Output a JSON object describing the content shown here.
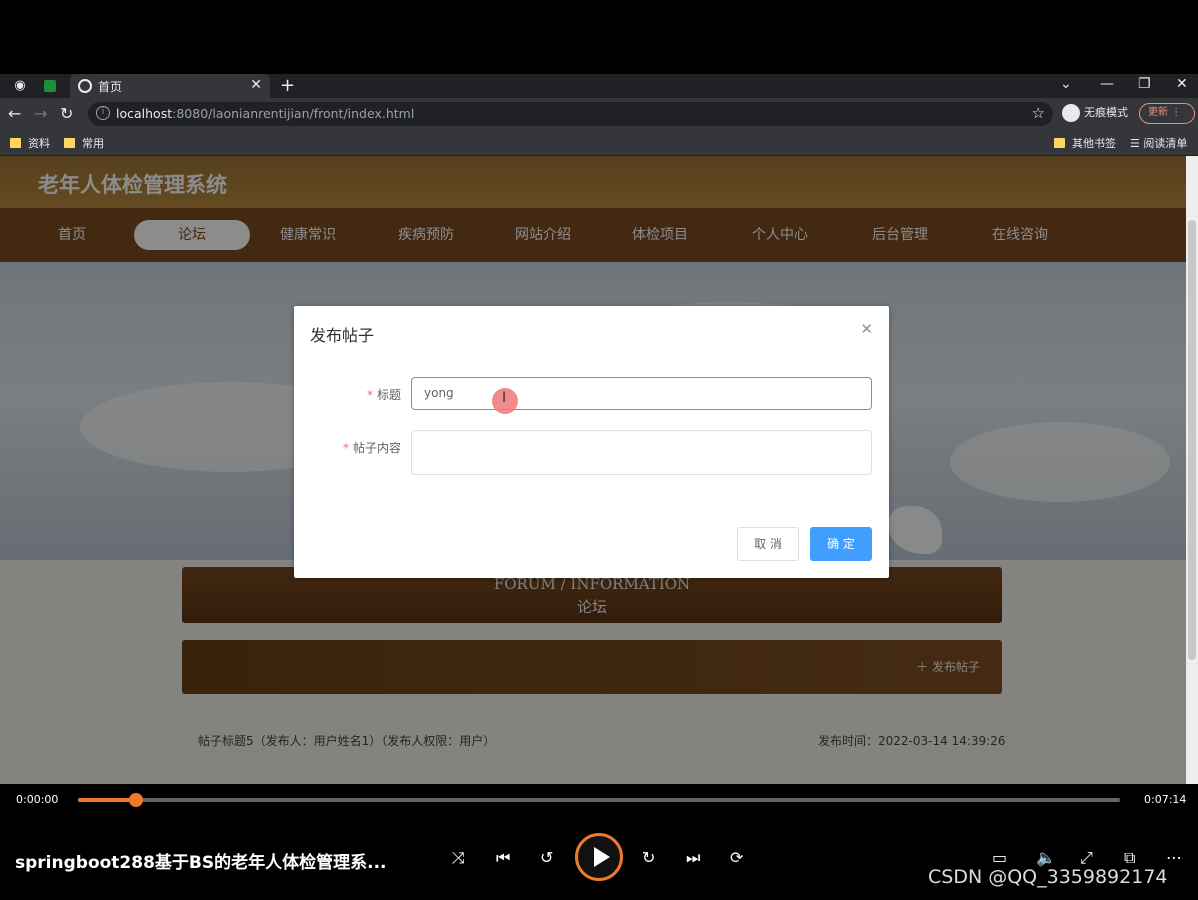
{
  "browser": {
    "tab_title": "首页",
    "url_host": "localhost",
    "url_rest": ":8080/laonianrentijian/front/index.html",
    "incognito_label": "无痕模式",
    "update_label": "更新",
    "bookmarks": [
      "资料",
      "常用"
    ],
    "other_bookmarks": "其他书签",
    "reading_list": "阅读清单"
  },
  "site": {
    "title": "老年人体检管理系统",
    "nav": [
      "首页",
      "论坛",
      "健康常识",
      "疾病预防",
      "网站介绍",
      "体检项目",
      "个人中心",
      "后台管理",
      "在线咨询"
    ],
    "active_nav": "论坛"
  },
  "forum": {
    "title_en": "FORUM / INFORMATION",
    "title_cn": "论坛",
    "post_button": "发布帖子",
    "rows": [
      {
        "text": "帖子标题5（发布人：用户姓名1）（发布人权限：用户）",
        "time": "发布时间：2022-03-14 14:39:26"
      }
    ]
  },
  "dialog": {
    "title": "发布帖子",
    "title_label": "标题",
    "title_value": "yong",
    "content_label": "帖子内容",
    "content_value": "",
    "cancel": "取 消",
    "ok": "确 定"
  },
  "player": {
    "current_time": "0:00:00",
    "total_time": "0:07:14",
    "progress": 0.056,
    "video_title": "springboot288基于BS的老年人体检管理系...",
    "watermark": "CSDN @QQ_3359892174"
  }
}
